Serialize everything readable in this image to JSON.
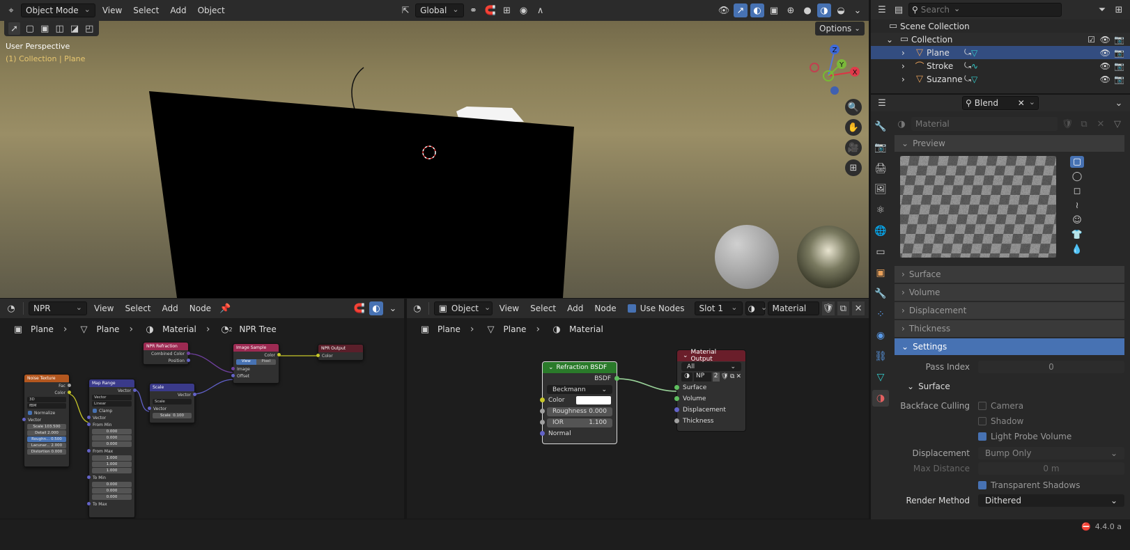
{
  "viewport": {
    "header": {
      "mode": "Object Mode",
      "menus": [
        "View",
        "Select",
        "Add",
        "Object"
      ],
      "orientation": "Global"
    },
    "options": "Options",
    "view_name": "User Perspective",
    "collection_text": "(1) Collection | Plane"
  },
  "npr_editor": {
    "tree": "NPR",
    "menus": [
      "View",
      "Select",
      "Add",
      "Node"
    ],
    "breadcrumb": [
      "Plane",
      "Plane",
      "Material",
      "NPR Tree"
    ],
    "users_sub": "2",
    "nodes": {
      "noise": {
        "title": "Noise Texture",
        "fac": "Fac",
        "color": "Color",
        "dim": "3D",
        "type": "fBM",
        "normalize": "Normalize",
        "vector": "Vector",
        "scale": "Scale",
        "scale_v": "103.500",
        "detail": "Detail",
        "detail_v": "2.000",
        "rough": "Roughn...",
        "rough_v": "0.500",
        "lac": "Lacunar...",
        "lac_v": "2.000",
        "dist": "Distortion",
        "dist_v": "0.000"
      },
      "maprange": {
        "title": "Map Range",
        "vector": "Vector",
        "dtype": "Vector",
        "interp": "Linear",
        "clamp": "Clamp",
        "vin": "Vector",
        "from_min": "From Min",
        "fmin": [
          "0.000",
          "0.000",
          "0.000"
        ],
        "from_max": "From Max",
        "fmax": [
          "1.000",
          "1.000",
          "1.000"
        ],
        "to_min": "To Min",
        "tmin": [
          "0.000",
          "0.000",
          "0.000"
        ],
        "to_max": "To Max"
      },
      "scale": {
        "title": "Scale",
        "vector": "Vector",
        "op": "Scale",
        "vin": "Vector",
        "scale": "Scale",
        "scale_v": "0.100"
      },
      "refr": {
        "title": "NPR Refraction",
        "combined": "Combined Color",
        "position": "Position"
      },
      "imgsample": {
        "title": "Image Sample",
        "color": "Color",
        "view": "View",
        "pixel": "Pixel",
        "image": "Image",
        "offset": "Offset"
      },
      "output": {
        "title": "NPR Output",
        "color": "Color"
      }
    }
  },
  "shader_editor": {
    "type": "Object",
    "menus": [
      "View",
      "Select",
      "Add",
      "Node"
    ],
    "use_nodes": "Use Nodes",
    "slot": "Slot 1",
    "material": "Material",
    "breadcrumb": [
      "Plane",
      "Plane",
      "Material"
    ],
    "refraction": {
      "title": "Refraction BSDF",
      "bsdf": "BSDF",
      "dist": "Beckmann",
      "color": "Color",
      "rough": "Roughness",
      "rough_v": "0.000",
      "ior": "IOR",
      "ior_v": "1.100",
      "normal": "Normal"
    },
    "matout": {
      "title": "Material Output",
      "target": "All",
      "np": "NP",
      "users": "2",
      "surface": "Surface",
      "volume": "Volume",
      "displacement": "Displacement",
      "thickness": "Thickness"
    }
  },
  "outliner": {
    "search_placeholder": "Search",
    "scene": "Scene Collection",
    "collection": "Collection",
    "objects": [
      "Plane",
      "Stroke",
      "Suzanne"
    ]
  },
  "properties": {
    "search": "Blend",
    "material_field": "Material",
    "sections": {
      "preview": "Preview",
      "surface": "Surface",
      "volume": "Volume",
      "displacement": "Displacement",
      "thickness": "Thickness",
      "settings": "Settings"
    },
    "pass_index_label": "Pass Index",
    "pass_index": "0",
    "surface_sub": "Surface",
    "backface": "Backface Culling",
    "camera": "Camera",
    "shadow": "Shadow",
    "light_probe": "Light Probe Volume",
    "displacement_label": "Displacement",
    "displacement_val": "Bump Only",
    "max_dist_label": "Max Distance",
    "max_dist_val": "0 m",
    "transparent_shadows": "Transparent Shadows",
    "render_method_label": "Render Method",
    "render_method": "Dithered"
  },
  "status": {
    "version": "4.4.0 a"
  }
}
